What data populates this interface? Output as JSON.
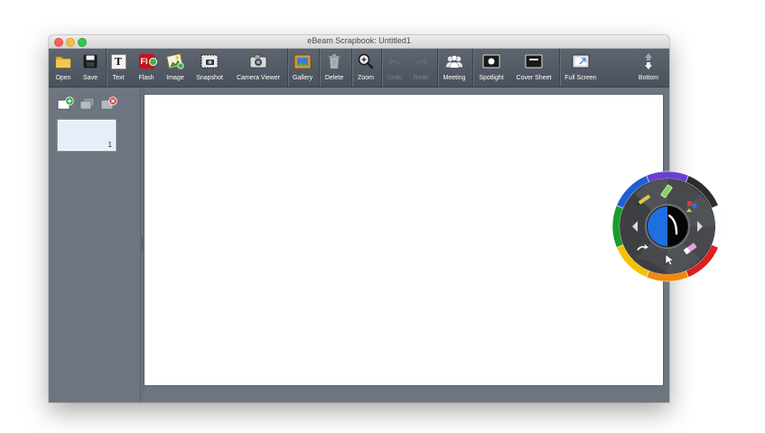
{
  "window": {
    "title": "eBeam Scrapbook: Untitled1"
  },
  "toolbar": {
    "open": "Open",
    "save": "Save",
    "text": "Text",
    "flash": "Flash",
    "image": "Image",
    "snapshot": "Snapshot",
    "camera_viewer": "Camera Viewer",
    "gallery": "Gallery",
    "delete": "Delete",
    "zoom": "Zoom",
    "undo": "Undo",
    "redo": "Redo",
    "meeting": "Meeting",
    "spotlight": "Spotlight",
    "cover_sheet": "Cover Sheet",
    "full_screen": "Full Screen",
    "bottom": "Bottom"
  },
  "sidebar": {
    "pages": [
      {
        "number": "1"
      }
    ]
  },
  "icons": {
    "text_glyph": "T",
    "flash_glyph": "Fl"
  },
  "colors": {
    "window_bg": "#6d7680",
    "toolbar_bg": "#535b65",
    "canvas": "#ffffff",
    "thumb_bg": "#e6eff8"
  },
  "pen_wheel": {
    "colors": [
      "#6a3fd1",
      "#2d2d2d",
      "#ffffff",
      "#dd1f1f",
      "#f08a10",
      "#f5c200",
      "#1a9c2a",
      "#1f5fd6"
    ]
  }
}
